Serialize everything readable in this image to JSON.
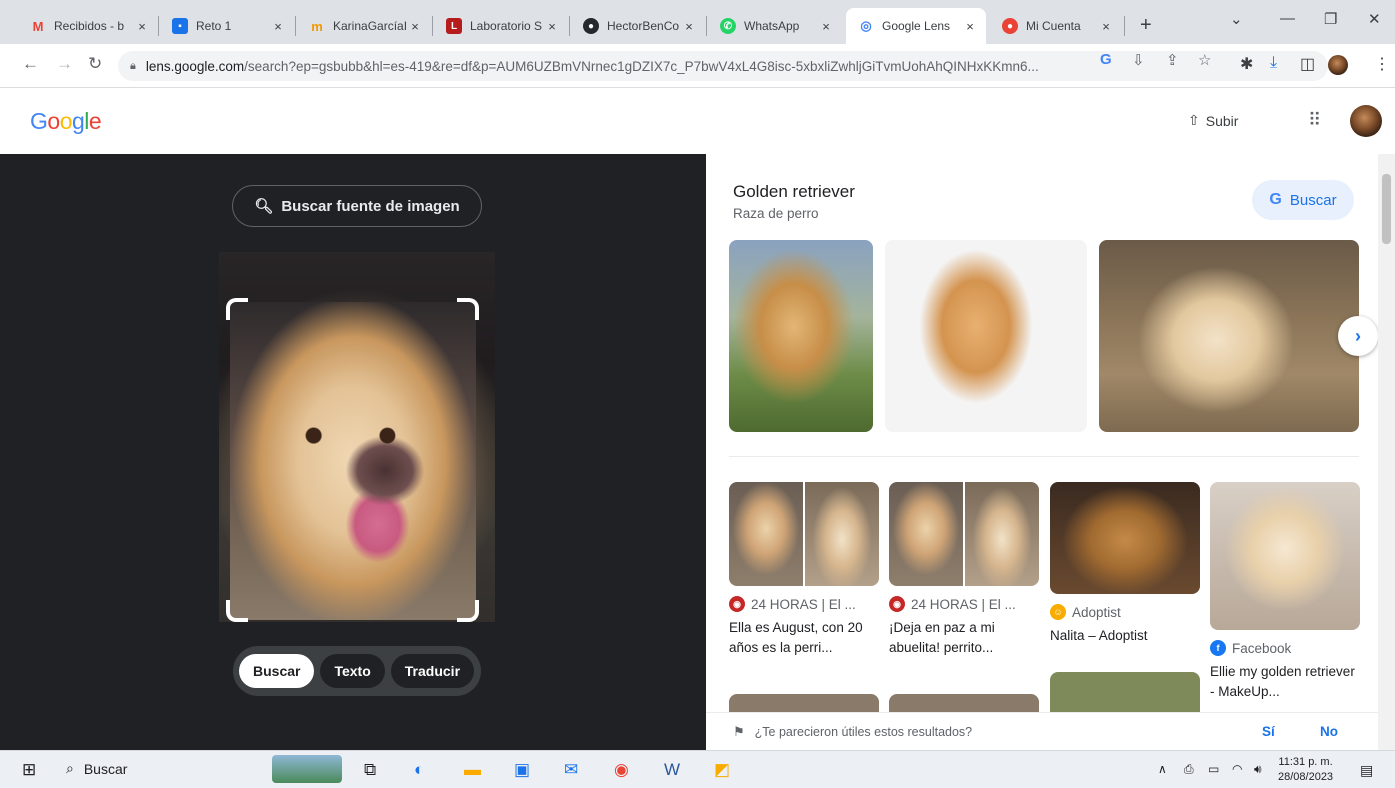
{
  "browser": {
    "tabs": [
      {
        "title": "Recibidos - b",
        "favicon": "M",
        "color": "#ea4335"
      },
      {
        "title": "Reto 1",
        "favicon": "▪",
        "color": "#1a73e8"
      },
      {
        "title": "KarinaGarcíaI",
        "favicon": "m",
        "color": "#f29900"
      },
      {
        "title": "Laboratorio S",
        "favicon": "L",
        "color": "#b71c1c"
      },
      {
        "title": "HectorBenCo",
        "favicon": "●",
        "color": "#24292e"
      },
      {
        "title": "WhatsApp",
        "favicon": "✆",
        "color": "#25d366"
      },
      {
        "title": "Google Lens",
        "favicon": "◎",
        "color": "#4285f4"
      },
      {
        "title": "Mi Cuenta",
        "favicon": "●",
        "color": "#ea4335"
      }
    ],
    "close_glyph": "×",
    "url_domain": "lens.google.com",
    "url_rest": "/search?ep=gsbubb&hl=es-419&re=df&p=AUM6UZBmVNrnec1gDZIX7c_P7bwV4xL4G8isc-5xbxliZwhljGiTvmUohAhQINHxKKmn6..."
  },
  "header": {
    "logo": "Google",
    "upload_label": "Subir"
  },
  "lens": {
    "source_button": "Buscar fuente de imagen",
    "modes": [
      "Buscar",
      "Texto",
      "Traducir"
    ]
  },
  "results": {
    "entity_title": "Golden retriever",
    "entity_subtitle": "Raza de perro",
    "search_button": "Buscar",
    "cards": [
      {
        "source": "24 HORAS | El ...",
        "caption": "Ella es August, con 20 años es la perri..."
      },
      {
        "source": "24 HORAS | El ...",
        "caption": "¡Deja en paz a mi abuelita! perrito..."
      },
      {
        "source": "Adoptist",
        "caption": "Nalita – Adoptist"
      },
      {
        "source": "Facebook",
        "caption": "Ellie my golden retriever - MakeUp..."
      }
    ],
    "feedback_question": "¿Te parecieron útiles estos resultados?",
    "feedback_yes": "Sí",
    "feedback_no": "No"
  },
  "taskbar": {
    "search_label": "Buscar",
    "time": "11:31 p. m.",
    "date": "28/08/2023"
  }
}
